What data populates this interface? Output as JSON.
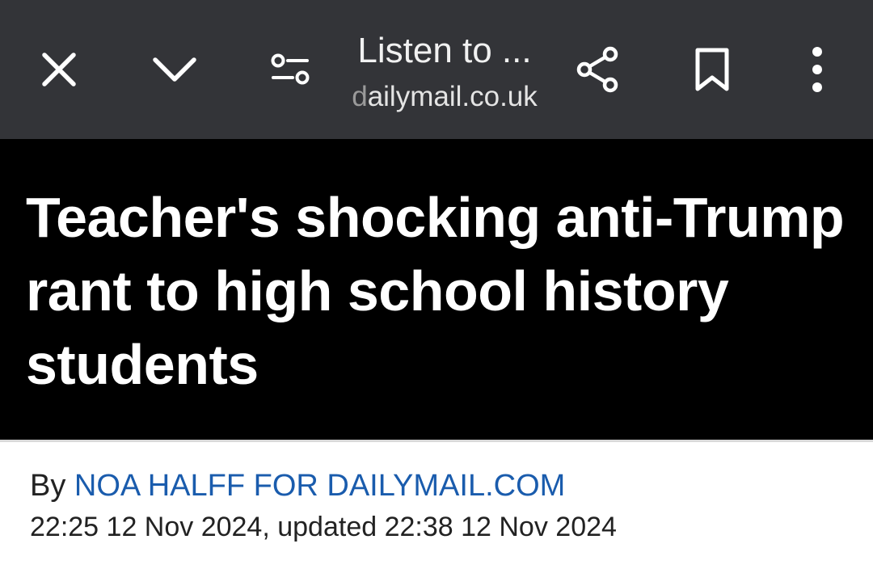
{
  "toolbar": {
    "title": "Listen to ...",
    "domain_dim": "d",
    "domain_rest": "ailymail.co.uk",
    "icons": {
      "close": "close-icon",
      "collapse": "chevron-down-icon",
      "tune": "tune-icon",
      "share": "share-icon",
      "bookmark": "bookmark-icon",
      "more": "more-vert-icon"
    },
    "colors": {
      "background": "#333438",
      "icon": "#ffffff"
    }
  },
  "article": {
    "headline": "Teacher's shocking anti-Trump rant to high school history students",
    "byline_prefix": "By ",
    "author": "NOA HALFF FOR DAILYMAIL.COM",
    "dateline": "22:25 12 Nov 2024, updated 22:38 12 Nov 2024",
    "colors": {
      "hero_background": "#000000",
      "headline": "#ffffff",
      "author_link": "#1a5cad"
    }
  }
}
